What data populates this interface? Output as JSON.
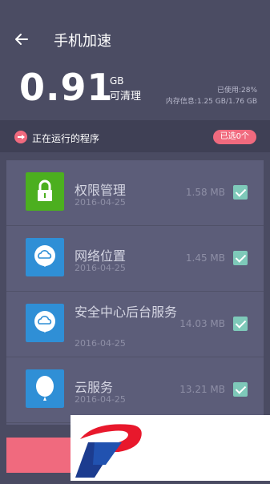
{
  "header": {
    "title": "手机加速",
    "big_value": "0.91",
    "unit": "GB",
    "cleanable_label": "可清理",
    "used_percent": "已使用:28%",
    "memory_info": "内存信息:1.25 GB/1.76 GB"
  },
  "running": {
    "label": "正在运行的程序",
    "selected_badge": "已选0个"
  },
  "apps": [
    {
      "name": "权限管理",
      "date": "2016-04-25",
      "size": "1.58 MB",
      "checked": true,
      "icon": "lock-icon",
      "color": "#4caf1f"
    },
    {
      "name": "网络位置",
      "date": "2016-04-25",
      "size": "1.45 MB",
      "checked": true,
      "icon": "cloud-location-icon",
      "color": "#2f8fd6"
    },
    {
      "name": "安全中心后台服务",
      "date": "2016-04-25",
      "size": "14.03 MB",
      "checked": true,
      "icon": "cloud-location-icon",
      "color": "#2f8fd6"
    },
    {
      "name": "云服务",
      "date": "2016-04-25",
      "size": "13.21 MB",
      "checked": true,
      "icon": "balloon-icon",
      "color": "#2f8fd6"
    }
  ],
  "colors": {
    "accent": "#f06a7e",
    "background": "#4a4b62",
    "check": "#7ec9b9"
  }
}
